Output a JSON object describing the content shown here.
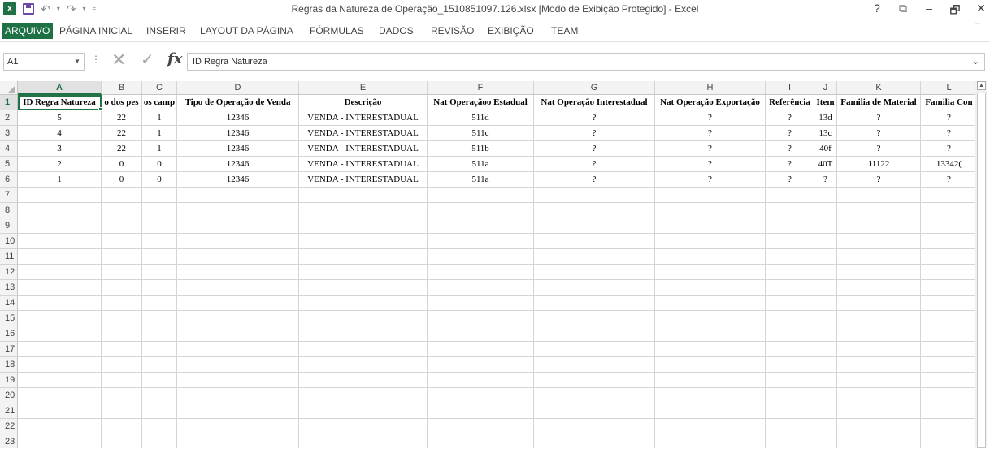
{
  "window": {
    "title": "Regras da Natureza de Operação_1510851097.126.xlsx  [Modo de Exibição Protegido] - Excel",
    "logo": "X",
    "controls": {
      "help": "?",
      "ribbon_options": "⧉",
      "minimize": "–",
      "restore": "🗗",
      "close": "✕"
    },
    "qat": {
      "undo": "↶",
      "undo_dd": "▾",
      "redo": "↷",
      "redo_dd": "▾",
      "customize": "="
    }
  },
  "ribbon": {
    "tabs": [
      {
        "label": "ARQUIVO"
      },
      {
        "label": "PÁGINA INICIAL"
      },
      {
        "label": "INSERIR"
      },
      {
        "label": "LAYOUT DA PÁGINA"
      },
      {
        "label": "FÓRMULAS"
      },
      {
        "label": "DADOS"
      },
      {
        "label": "REVISÃO"
      },
      {
        "label": "EXIBIÇÃO"
      },
      {
        "label": "TEAM"
      }
    ],
    "collapse": "ˇ"
  },
  "formula_bar": {
    "name_box": "A1",
    "name_box_dd": "▼",
    "separator": "⋮",
    "cancel": "✕",
    "enter": "✓",
    "fx": "fx",
    "value": "ID Regra Natureza",
    "expand": "⌄"
  },
  "grid": {
    "columns": [
      "A",
      "B",
      "C",
      "D",
      "E",
      "F",
      "G",
      "H",
      "I",
      "J",
      "K",
      "L"
    ],
    "selected_column": "A",
    "selected_row": 1,
    "rows": [
      [
        "ID Regra Natureza",
        "o dos pes",
        "os camp",
        "Tipo de Operação de Venda",
        "Descrição",
        "Nat Operaçãoo Estadual",
        "Nat Operação Interestadual",
        "Nat Operação Exportação",
        "Referência",
        "Item",
        "Familia de Material",
        "Familia Con"
      ],
      [
        "5",
        "22",
        "1",
        "12346",
        "VENDA - INTERESTADUAL",
        "511d",
        "?",
        "?",
        "?",
        "13d",
        "?",
        "?"
      ],
      [
        "4",
        "22",
        "1",
        "12346",
        "VENDA - INTERESTADUAL",
        "511c",
        "?",
        "?",
        "?",
        "13c",
        "?",
        "?"
      ],
      [
        "3",
        "22",
        "1",
        "12346",
        "VENDA - INTERESTADUAL",
        "511b",
        "?",
        "?",
        "?",
        "40f",
        "?",
        "?"
      ],
      [
        "2",
        "0",
        "0",
        "12346",
        "VENDA - INTERESTADUAL",
        "511a",
        "?",
        "?",
        "?",
        "40T",
        "11122",
        "13342("
      ],
      [
        "1",
        "0",
        "0",
        "12346",
        "VENDA - INTERESTADUAL",
        "511a",
        "?",
        "?",
        "?",
        "?",
        "?",
        "?"
      ]
    ],
    "row_numbers": [
      "1",
      "2",
      "3",
      "4",
      "5",
      "6",
      "7",
      "8",
      "9",
      "10",
      "11",
      "12",
      "13",
      "14",
      "15",
      "16",
      "17",
      "18",
      "19",
      "20",
      "21",
      "22",
      "23"
    ]
  },
  "scrollbar": {
    "up": "▲"
  }
}
